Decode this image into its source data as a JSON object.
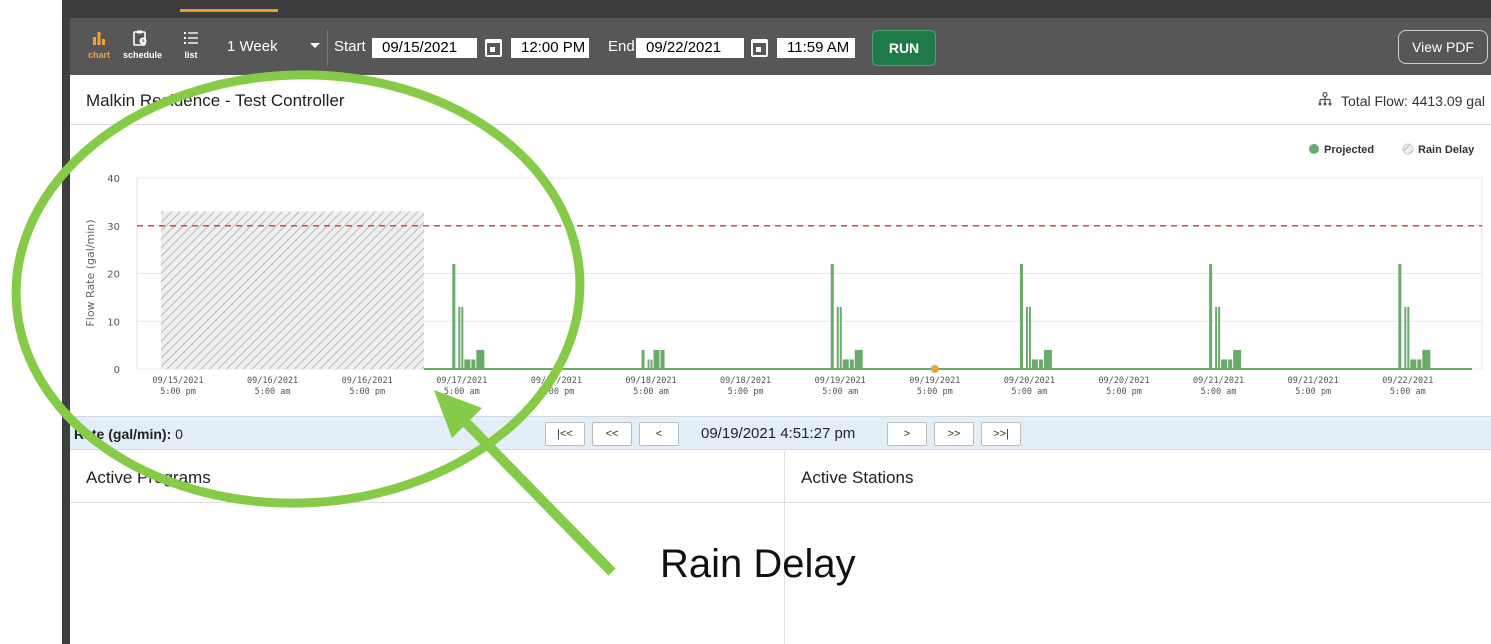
{
  "toolbar": {
    "views": [
      {
        "label": "chart",
        "icon": "bar-chart-icon",
        "active": true
      },
      {
        "label": "schedule",
        "icon": "clipboard-clock-icon",
        "active": false
      },
      {
        "label": "list",
        "icon": "list-icon",
        "active": false
      }
    ],
    "range": "1 Week",
    "start_label": "Start",
    "start_date": "09/15/2021",
    "start_time": "12:00 PM",
    "end_label": "End",
    "end_date": "09/22/2021",
    "end_time": "11:59 AM",
    "run_label": "RUN",
    "pdf_label": "View PDF",
    "colors": {
      "bar": "#575757",
      "active": "#f0a238",
      "run": "#1f7a4a"
    }
  },
  "header": {
    "controller": "Malkin Residence - Test Controller",
    "total_flow": "Total Flow: 4413.09 gal",
    "total_flow_icon": "network-icon"
  },
  "chart_data": {
    "type": "area",
    "ylabel": "Flow Rate (gal/min)",
    "ylim": [
      0,
      40
    ],
    "yticks": [
      "0",
      "10",
      "20",
      "30",
      "40"
    ],
    "xticks": [
      [
        "09/15/2021",
        "5:00 pm"
      ],
      [
        "09/16/2021",
        "5:00 am"
      ],
      [
        "09/16/2021",
        "5:00 pm"
      ],
      [
        "09/17/2021",
        "5:00 am"
      ],
      [
        "09/17/2021",
        "5:00 pm"
      ],
      [
        "09/18/2021",
        "5:00 am"
      ],
      [
        "09/18/2021",
        "5:00 pm"
      ],
      [
        "09/19/2021",
        "5:00 am"
      ],
      [
        "09/19/2021",
        "5:00 pm"
      ],
      [
        "09/20/2021",
        "5:00 am"
      ],
      [
        "09/20/2021",
        "5:00 pm"
      ],
      [
        "09/21/2021",
        "5:00 am"
      ],
      [
        "09/21/2021",
        "5:00 pm"
      ],
      [
        "09/22/2021",
        "5:00 am"
      ]
    ],
    "legend": [
      {
        "name": "Projected",
        "color": "#6aaa6a"
      },
      {
        "name": "Rain Delay",
        "color": "#c8c8c8"
      }
    ],
    "legend_position": "top-right",
    "threshold": 30,
    "threshold_color": "#e84040",
    "rain_delay": {
      "start": -0.18,
      "end": 2.6,
      "value": 33
    },
    "cursor": {
      "x": 8.0,
      "value": 0,
      "color": "#f0a238"
    },
    "events": [
      {
        "x": 2.9,
        "profile": [
          22,
          13,
          13,
          2,
          2,
          4
        ]
      },
      {
        "x": 4.9,
        "profile": [
          4,
          2,
          2,
          4,
          4
        ]
      },
      {
        "x": 6.9,
        "profile": [
          22,
          13,
          13,
          2,
          2,
          4
        ]
      },
      {
        "x": 8.9,
        "profile": [
          22,
          13,
          13,
          2,
          2,
          4
        ]
      },
      {
        "x": 10.9,
        "profile": [
          22,
          13,
          13,
          2,
          2,
          4
        ]
      },
      {
        "x": 12.9,
        "profile": [
          22,
          13,
          13,
          2,
          2,
          4
        ]
      }
    ]
  },
  "status": {
    "rate_label": "Rate (gal/min):",
    "rate_value": "0",
    "nav": [
      "|<<",
      "<<",
      "<",
      ">",
      ">>",
      ">>|"
    ],
    "timestamp": "09/19/2021 4:51:27 pm"
  },
  "panels": {
    "programs": "Active Programs",
    "stations": "Active Stations"
  },
  "annotation": {
    "label": "Rain Delay",
    "color": "#86cb48"
  }
}
